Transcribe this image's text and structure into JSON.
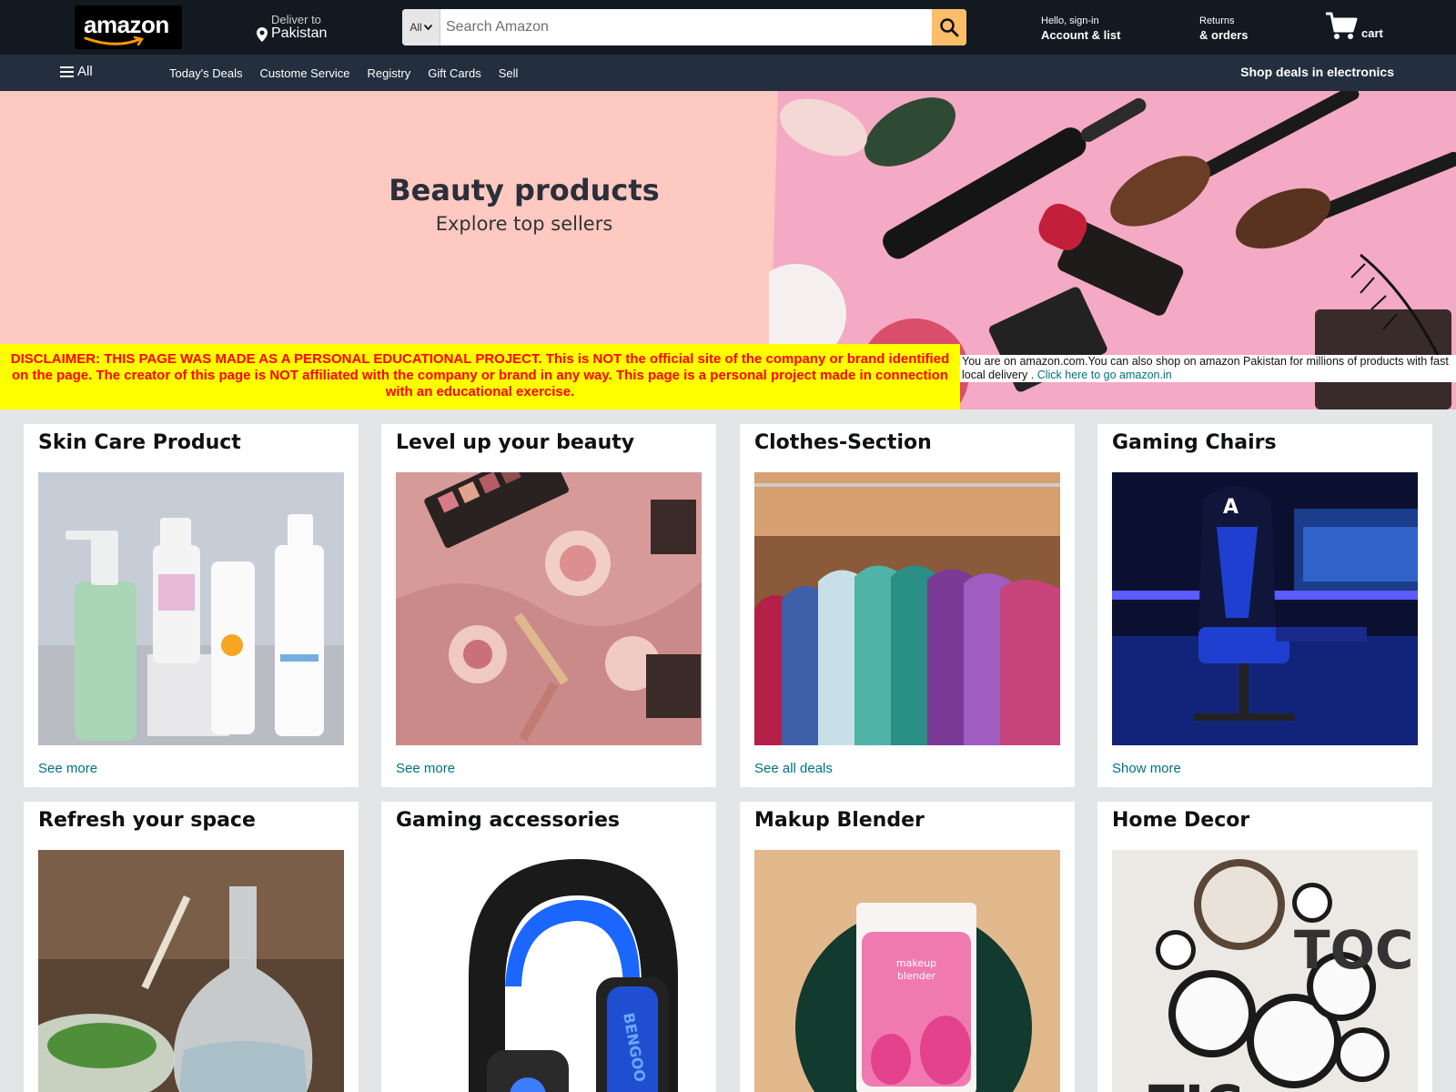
{
  "header": {
    "logo_text": "amazon",
    "deliver_small": "Deliver to",
    "deliver_location": "Pakistan",
    "search_category": "All",
    "search_placeholder": "Search Amazon",
    "account_small": "Hello, sign-in",
    "account_bold": "Account & list",
    "returns_small": "Returns",
    "returns_bold": "& orders",
    "cart_label": "cart"
  },
  "subnav": {
    "all_label": "All",
    "links": [
      "Today's Deals",
      "Custome Service",
      "Registry",
      "Gift Cards",
      "Sell"
    ],
    "promo": "Shop deals in electronics"
  },
  "hero": {
    "title": "Beauty products",
    "subtitle": "Explore top sellers"
  },
  "disclaimer": "DISCLAIMER: THIS PAGE WAS MADE AS A PERSONAL EDUCATIONAL PROJECT. This is NOT the official site of the company or brand identified on the page. The creator of this page is NOT affiliated with the company or brand in any way. This page is a personal project made in connection with an educational exercise.",
  "notice": {
    "text": "You are on amazon.com.You can also shop on amazon Pakistan for millions of products with fast local delivery .",
    "link": "Click here to go amazon.in"
  },
  "cards": [
    {
      "title": "Skin Care Product",
      "link": "See more"
    },
    {
      "title": "Level up your beauty",
      "link": "See more"
    },
    {
      "title": "Clothes-Section",
      "link": "See all deals"
    },
    {
      "title": "Gaming Chairs",
      "link": "Show more"
    },
    {
      "title": "Refresh your space",
      "link": ""
    },
    {
      "title": "Gaming accessories",
      "link": ""
    },
    {
      "title": "Makup Blender",
      "link": ""
    },
    {
      "title": "Home Decor",
      "link": ""
    }
  ],
  "colors": {
    "nav_top": "#131921",
    "nav_sub": "#232f3e",
    "search_button": "#febd69",
    "hero_bg": "#fdc9c1",
    "disclaimer_bg": "#ffff00",
    "disclaimer_text": "#ff0000",
    "link": "#007185",
    "page_bg": "#e3e6e6"
  },
  "icons": [
    "amazon-smile-icon",
    "location-pin-icon",
    "chevron-down-icon",
    "search-icon",
    "cart-icon",
    "hamburger-menu-icon"
  ]
}
